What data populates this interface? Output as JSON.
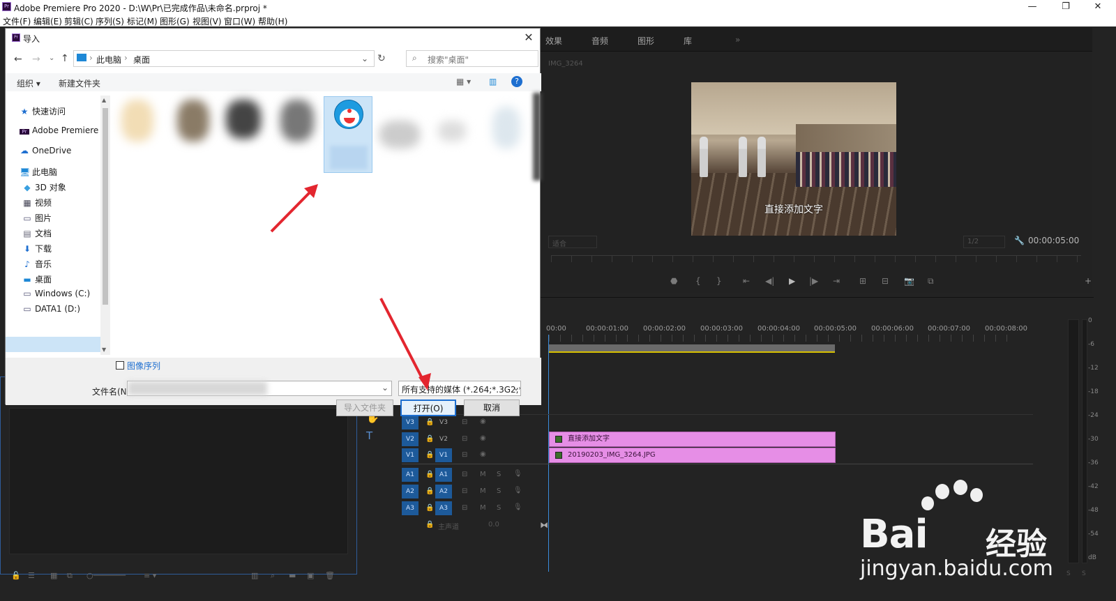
{
  "window": {
    "title": "Adobe Premiere Pro 2020 - D:\\W\\Pr\\已完成作品\\未命名.prproj *",
    "app_icon": "Pr"
  },
  "menu": [
    "文件(F)",
    "编辑(E)",
    "剪辑(C)",
    "序列(S)",
    "标记(M)",
    "图形(G)",
    "视图(V)",
    "窗口(W)",
    "帮助(H)"
  ],
  "right_tabs": [
    "效果",
    "音频",
    "图形",
    "库"
  ],
  "monitor": {
    "clip_name": "IMG_3264",
    "overlay_text": "直接添加文字",
    "fit": "适合",
    "ratio": "1/2",
    "timecode": "00:00:05:00"
  },
  "timeline": {
    "ticks": [
      "00:00",
      "00:00:01:00",
      "00:00:02:00",
      "00:00:03:00",
      "00:00:04:00",
      "00:00:05:00",
      "00:00:06:00",
      "00:00:07:00",
      "00:00:08:00"
    ],
    "tracks": [
      {
        "src": "V3",
        "dst": "V3"
      },
      {
        "src": "V2",
        "dst": "V2"
      },
      {
        "src": "V1",
        "dst": "V1"
      },
      {
        "src": "A1",
        "dst": "A1"
      },
      {
        "src": "A2",
        "dst": "A2"
      },
      {
        "src": "A3",
        "dst": "A3"
      }
    ],
    "master": {
      "label": "主声道",
      "value": "0.0"
    },
    "clips": [
      "直接添加文字",
      "20190203_IMG_3264.JPG"
    ]
  },
  "meter_scale": [
    "0",
    "-6",
    "-12",
    "-18",
    "-24",
    "-30",
    "-36",
    "-42",
    "-48",
    "-54",
    "dB"
  ],
  "meter_solo": [
    "S",
    "S"
  ],
  "dialog": {
    "title": "导入",
    "breadcrumb": [
      "此电脑",
      "桌面"
    ],
    "search_placeholder": "搜索\"桌面\"",
    "toolbar": {
      "organize": "组织 ▾",
      "new_folder": "新建文件夹"
    },
    "nav": [
      {
        "icon": "star-icon",
        "label": "快速访问"
      },
      {
        "icon": "premiere-icon",
        "label": "Adobe Premiere"
      },
      {
        "icon": "cloud-icon",
        "label": "OneDrive"
      },
      {
        "icon": "pc-icon",
        "label": "此电脑"
      },
      {
        "icon": "cube-icon",
        "label": "3D 对象"
      },
      {
        "icon": "video-icon",
        "label": "视频"
      },
      {
        "icon": "picture-icon",
        "label": "图片"
      },
      {
        "icon": "document-icon",
        "label": "文档"
      },
      {
        "icon": "download-icon",
        "label": "下载"
      },
      {
        "icon": "music-icon",
        "label": "音乐"
      },
      {
        "icon": "desktop-icon",
        "label": "桌面"
      },
      {
        "icon": "drive-icon",
        "label": "Windows (C:)"
      },
      {
        "icon": "drive-icon",
        "label": "DATA1 (D:)"
      }
    ],
    "image_sequence": "图像序列",
    "filename_label": "文件名(N",
    "filename_value": "",
    "filetype": "所有支持的媒体 (*.264;*.3G2;*.",
    "buttons": {
      "import_folder": "导入文件夹",
      "open": "打开(O)",
      "cancel": "取消"
    }
  },
  "watermark": {
    "brand_a": "Bai",
    "brand_b": "经验",
    "url": "jingyan.baidu.com"
  },
  "colors": {
    "track_blue": "#1d5a9a",
    "clip_pink": "#e68ee6",
    "arrow_red": "#e3262f",
    "selection": "#cce4f7"
  }
}
